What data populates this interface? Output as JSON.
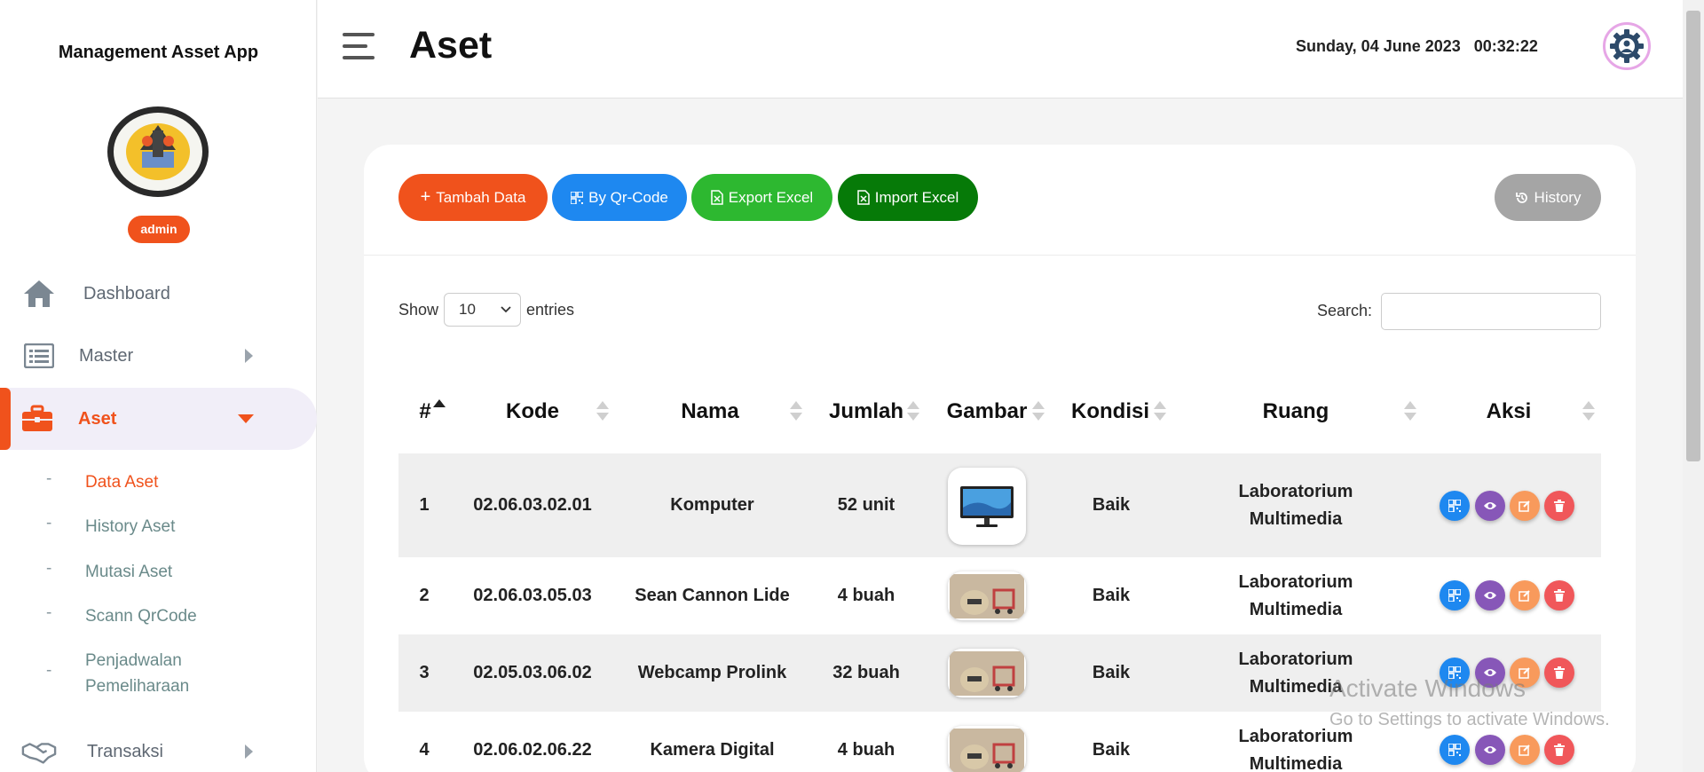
{
  "app": {
    "title": "Management Asset App",
    "role": "admin"
  },
  "sidebar": {
    "items": [
      {
        "label": "Dashboard",
        "icon": "home-icon"
      },
      {
        "label": "Master",
        "icon": "list-icon"
      },
      {
        "label": "Aset",
        "icon": "briefcase-icon",
        "active": true
      },
      {
        "label": "Transaksi",
        "icon": "handshake-icon"
      }
    ],
    "sub_items": [
      {
        "label": "Data Aset",
        "active": true
      },
      {
        "label": "History Aset"
      },
      {
        "label": "Mutasi Aset"
      },
      {
        "label": "Scann QrCode"
      },
      {
        "label": "Penjadwalan Pemeliharaan"
      }
    ],
    "dash": "-"
  },
  "header": {
    "title": "Aset",
    "date": "Sunday, 04 June 2023",
    "time": "00:32:22"
  },
  "toolbar": {
    "add": "Tambah Data",
    "qr": "By Qr-Code",
    "export": "Export Excel",
    "import": "Import Excel",
    "history": "History"
  },
  "table_controls": {
    "show": "Show",
    "entries_value": "10",
    "entries": "entries",
    "search_label": "Search:",
    "search_value": ""
  },
  "table": {
    "columns": [
      "#",
      "Kode",
      "Nama",
      "Jumlah",
      "Gambar",
      "Kondisi",
      "Ruang",
      "Aksi"
    ],
    "rows": [
      {
        "no": "1",
        "kode": "02.06.03.02.01",
        "nama": "Komputer",
        "jumlah": "52 unit",
        "kondisi": "Baik",
        "ruang": "Laboratorium Multimedia",
        "image": "monitor-image"
      },
      {
        "no": "2",
        "kode": "02.06.03.05.03",
        "nama": "Sean Cannon Lide",
        "jumlah": "4 buah",
        "kondisi": "Baik",
        "ruang": "Laboratorium Multimedia",
        "image": "assets-bag-image"
      },
      {
        "no": "3",
        "kode": "02.05.03.06.02",
        "nama": "Webcamp Prolink",
        "jumlah": "32 buah",
        "kondisi": "Baik",
        "ruang": "Laboratorium Multimedia",
        "image": "assets-bag-image"
      },
      {
        "no": "4",
        "kode": "02.06.02.06.22",
        "nama": "Kamera Digital",
        "jumlah": "4 buah",
        "kondisi": "Baik",
        "ruang": "Laboratorium Multimedia",
        "image": "assets-bag-image"
      }
    ]
  },
  "watermark": {
    "line1": "Activate Windows",
    "line2": "Go to Settings to activate Windows."
  },
  "colors": {
    "accent": "#f0521c",
    "qr": "#1e88f0",
    "export": "#2db830",
    "import": "#067a08",
    "history": "#a5a5a5"
  }
}
